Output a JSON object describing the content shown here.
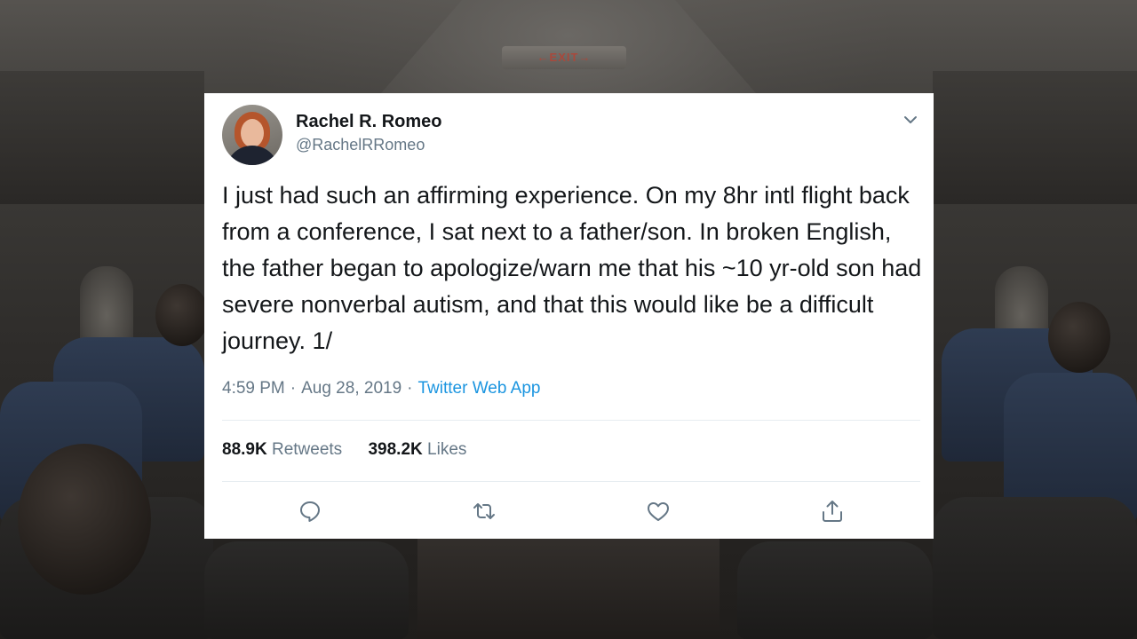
{
  "background": {
    "exit_sign": "←EXIT→"
  },
  "tweet": {
    "author": {
      "display_name": "Rachel R. Romeo",
      "handle": "@RachelRRomeo"
    },
    "text": "I just had such an affirming experience. On my 8hr intl flight back from a conference, I sat next to a father/son. In broken English, the father began to apologize/warn me that his ~10 yr-old son had severe nonverbal autism, and that this would like be a difficult journey. 1/",
    "time": "4:59 PM",
    "date": "Aug 28, 2019",
    "separator": "·",
    "source": "Twitter Web App",
    "stats": {
      "retweets_count": "88.9K",
      "retweets_label": "Retweets",
      "likes_count": "398.2K",
      "likes_label": "Likes"
    },
    "actions": [
      "reply-icon",
      "retweet-icon",
      "like-icon",
      "share-icon"
    ]
  },
  "colors": {
    "text_primary": "#14171a",
    "text_secondary": "#657786",
    "link": "#1b95e0",
    "divider": "#e6ecf0"
  }
}
